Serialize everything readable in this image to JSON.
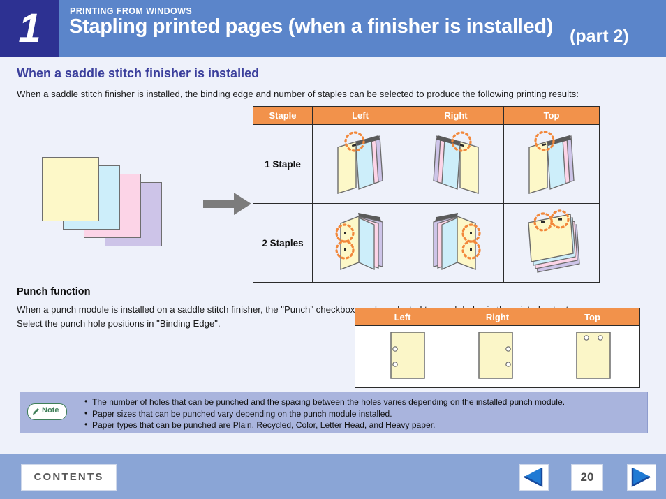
{
  "header": {
    "chapter_number": "1",
    "kicker": "PRINTING FROM WINDOWS",
    "title": "Stapling printed pages (when a finisher is installed)",
    "part_label": "(part 2)",
    "bg_color": "#5b85ca",
    "badge_color": "#2d3192"
  },
  "section": {
    "title": "When a saddle stitch finisher is installed",
    "title_color": "#3b3f9c",
    "intro": "When a saddle stitch finisher is installed, the binding edge and number of staples can be selected to produce the following printing results:"
  },
  "sheets_illustration": {
    "name": "stack-of-printed-sheets",
    "sheet_colors": [
      "#fdf8c8",
      "#cdeefa",
      "#fcd4e7",
      "#cdc4e8"
    ],
    "arrow": "right-arrow",
    "arrow_color": "#7c7c7c"
  },
  "staple_table": {
    "header_bg": "#f2924b",
    "columns": [
      "Staple",
      "Left",
      "Right",
      "Top"
    ],
    "rows": [
      {
        "label": "1 Staple",
        "cells": [
          "booklet-staple-left",
          "booklet-staple-right",
          "booklet-staple-top"
        ]
      },
      {
        "label": "2 Staples",
        "cells": [
          "booklet-2staples-left",
          "booklet-2staples-right",
          "stack-2staples-top"
        ]
      }
    ]
  },
  "punch": {
    "title": "Punch function",
    "description": "When a punch module is installed on a saddle stitch finisher, the \"Punch\" checkbox can be selected to punch holes in the printed output.\nSelect the punch hole positions in \"Binding Edge\".",
    "table": {
      "header_bg": "#f2924b",
      "columns": [
        "Left",
        "Right",
        "Top"
      ],
      "cells": [
        "page-punch-left",
        "page-punch-right",
        "page-punch-top"
      ]
    }
  },
  "note": {
    "badge_label": "Note",
    "badge_color": "#3f7f58",
    "bg_color": "#a9b4dd",
    "items": [
      "The number of holes that can be punched and the spacing between the holes varies depending on the installed punch module.",
      "Paper sizes that can be punched vary depending on the punch module installed.",
      "Paper types that can be punched are Plain, Recycled, Color, Letter Head, and Heavy paper."
    ]
  },
  "footer": {
    "bg_color": "#8aa5d6",
    "contents_label": "CONTENTS",
    "page_number": "20",
    "prev_icon": "left-triangle-icon",
    "next_icon": "right-triangle-icon",
    "nav_color": "#1f7ad4"
  }
}
